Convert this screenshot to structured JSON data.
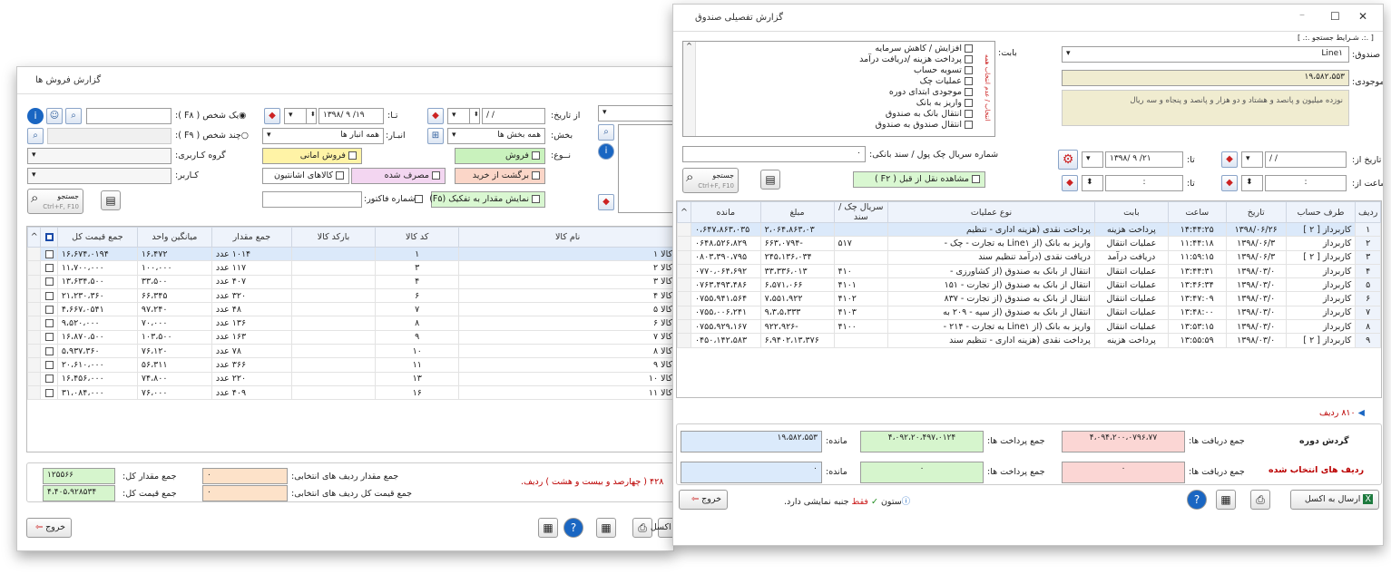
{
  "sales": {
    "title": "گزارش فروش ها",
    "from_date_label": "از تاریخ:",
    "from_date": "/ /",
    "to_label": "تـا:",
    "to_date": "۱۳۹۸/ ۹ /۱۹",
    "single_person": "یک شخص ( F۸ ):",
    "multi_person": "چند شخص ( F۹ ):",
    "section_label": "بخش:",
    "section_value": "همه بخش ها",
    "store_label": "انبـار:",
    "store_value": "همه انبار ها",
    "user_group_label": "گروه کـاربری:",
    "user_label": "کـاربر:",
    "type_label": "نــوع:",
    "type_sale": "فروش",
    "type_trust": "فروش امانی",
    "type_return": "برگشت از خرید",
    "type_consume": "مصرف شده",
    "type_atelier": "کالاهای اشانتیون",
    "show_detail": "نمایش مقدار به تفکیک (F۵)",
    "invoice_label": "شماره فاکتور:",
    "search_label": "جستجو",
    "search_hint": "Ctrl+F, F10",
    "headers": [
      "جمع قیمت کل",
      "میانگین واحد",
      "جمع مقدار",
      "بارکد کالا",
      "کد کالا",
      "نام کالا"
    ],
    "rows": [
      [
        "۱۶،۶۷۴،۰۱۹۴",
        "۱۶،۴۷۲",
        "۱۰۱۴ عدد",
        "",
        "۱",
        "کالا ۱"
      ],
      [
        "۱۱،۷۰۰،۰۰۰",
        "۱۰۰،۰۰۰",
        "۱۱۷ عدد",
        "",
        "۳",
        "کالا ۲"
      ],
      [
        "۱۳،۶۳۴،۵۰۰",
        "۳۳،۵۰۰",
        "۴۰۷ عدد",
        "",
        "۴",
        "کالا ۳"
      ],
      [
        "۲۱،۲۳۰،۳۶۰",
        "۶۶،۳۴۵",
        "۳۲۰ عدد",
        "",
        "۶",
        "کالا ۴"
      ],
      [
        "۴،۶۶۷،۰۵۴۱",
        "۹۷،۲۴۰",
        "۴۸ عدد",
        "",
        "۷",
        "کالا ۵"
      ],
      [
        "۹،۵۲۰،۰۰۰",
        "۷۰،۰۰۰",
        "۱۳۶ عدد",
        "",
        "۸",
        "کالا ۶"
      ],
      [
        "۱۶،۸۷۰،۵۰۰",
        "۱۰۳،۵۰۰",
        "۱۶۳ عدد",
        "",
        "۹",
        "کالا ۷"
      ],
      [
        "۵،۹۳۷،۳۶۰",
        "۷۶،۱۲۰",
        "۷۸ عدد",
        "",
        "۱۰",
        "کالا ۸"
      ],
      [
        "۲۰،۶۱۰،۰۰۰",
        "۵۶،۳۱۱",
        "۳۶۶ عدد",
        "",
        "۱۱",
        "کالا ۹"
      ],
      [
        "۱۶،۴۵۶،۰۰۰",
        "۷۴،۸۰۰",
        "۲۲۰ عدد",
        "",
        "۱۳",
        "کالا ۱۰"
      ],
      [
        "۳۱،۰۸۴،۰۰۰",
        "۷۶،۰۰۰",
        "۴۰۹ عدد",
        "",
        "۱۶",
        "کالا ۱۱"
      ]
    ],
    "row_count_text": "۴۲۸ ( چهارصد و بیست و هشت ) ردیف.",
    "total_qty_label": "جمع مقدار کل:",
    "total_qty": "۱۲۵۵۶۶",
    "total_price_label": "جمع قیمت کل:",
    "total_price": "۴،۴۰۵،۹۲۸۵۳۴",
    "sel_qty_label": "جمع مقدار ردیف های انتخابی:",
    "sel_qty": "۰",
    "sel_price_label": "جمع قیمت کل ردیف های انتخابی:",
    "sel_price": "۰",
    "excel_label": "ارسال به اکسل",
    "exit_label": "خروج"
  },
  "fund": {
    "title": "گزارش تفصیلی صندوق",
    "criteria": "[ .:. شـرایط جستجو .:. ]",
    "fund_label": "صندوق:",
    "fund_value": "Line۱",
    "balance_label": "موجودی:",
    "balance_value": "۱۹،۵۸۲،۵۵۳",
    "balance_words": "نوزده میلیون و پانصد و هشتاد و دو هزار و پانصد و پنجاه و سه ریال",
    "bab_label": "بابت:",
    "side_label": "انتخاب / عدم انتخاب همه",
    "categories": [
      "افزایش / کاهش سرمایه",
      "پرداخت هزینه /دریافت درآمد",
      "تسویه حساب",
      "عملیات چک",
      "موجودی ابتدای دوره",
      "واریز به بانک",
      "انتقال بانک به صندوق",
      "انتقال صندوق به صندوق"
    ],
    "serial_label": "شماره سریال چک پول / سند بانکی:",
    "date_from_label": "تاریخ از:",
    "date_from": "/ /",
    "date_to_label": "تا:",
    "date_to": "۱۳۹۸/ ۹ /۲۱",
    "time_from_label": "ساعت از:",
    "time_from": ":",
    "time_to_label": "تا:",
    "time_to": ":",
    "search_label": "جستجو",
    "search_hint": "Ctrl+F, F10",
    "prev_transfer": "مشاهده نقل از قبل ( F۲ )",
    "headers": [
      "ردیف",
      "طرف حساب",
      "تاریخ",
      "ساعت",
      "بابت",
      "نوع عملیات",
      "سریال چک / سند",
      "مبلغ",
      "مانده"
    ],
    "rows": [
      [
        "۱",
        "کاربرداز [ ۲ ]",
        "۱۳۹۸/۰۶/۲۶",
        "۱۴:۴۴:۲۵",
        "پرداخت هزینه",
        "پرداخت نقدی (هزینه اداری - تنظیم",
        "",
        "۲،۰۶۴،۸۶۳،۰۳",
        "۰،۶۴۷،۸۶۳،۰۳۵"
      ],
      [
        "۲",
        "کاربرداز",
        "۱۳۹۸/۰۶/۳",
        "۱۱:۴۴:۱۸",
        "عملیات انتقال",
        "واریز به بانک (از Line۱ به تجارت - چک -",
        "۵۱۷",
        "-۶۶۳،۰۷۹۴",
        "۰۶۴۸،۵۲۶،۸۲۹"
      ],
      [
        "۳",
        "کاربرداز [ ۲ ]",
        "۱۳۹۸/۰۶/۳",
        "۱۱:۵۹:۱۵",
        "دریافت درآمد",
        "دریافت نقدی (درآمد تنظیم سند",
        "",
        "۲۴۵،۱۳۶،۰۳۴",
        "۰۸۰۳،۳۹۰،۷۹۵"
      ],
      [
        "۴",
        "کاربرداز",
        "۱۳۹۸/۰۳/۰",
        "۱۳:۴۴:۳۱",
        "عملیات انتقال",
        "انتقال از بانک به صندوق (از کشاورزی -",
        "۴۱۰",
        "۳۳،۳۳۶،۰۱۳",
        "۰۷۷۰،۰۶۴،۶۹۲"
      ],
      [
        "۵",
        "کاربرداز",
        "۱۳۹۸/۰۳/۰",
        "۱۳:۴۶:۳۴",
        "عملیات انتقال",
        "انتقال از بانک به صندوق (از تجارت - ۱۵۱",
        "۴۱۰۱",
        "۶،۵۷۱،۰۶۶",
        "۰۷۶۳،۴۹۳،۴۸۶"
      ],
      [
        "۶",
        "کاربرداز",
        "۱۳۹۸/۰۳/۰",
        "۱۳:۴۷:۰۹",
        "عملیات انتقال",
        "انتقال از بانک به صندوق (از تجارت - ۸۳۷",
        "۴۱۰۲",
        "۷،۵۵۱،۹۲۲",
        "۰۷۵۵،۹۴۱،۵۶۴"
      ],
      [
        "۷",
        "کاربرداز",
        "۱۳۹۸/۰۳/۰",
        "۱۳:۴۸:۰۰",
        "عملیات انتقال",
        "انتقال از بانک به صندوق (از سپه - ۲۰۹ به",
        "۴۱۰۳",
        "۹،۳،۵،۳۳۳",
        "۰۷۵۵،۰۰۶،۲۴۱"
      ],
      [
        "۸",
        "کاربرداز",
        "۱۳۹۸/۰۳/۰",
        "۱۳:۵۳:۱۵",
        "عملیات انتقال",
        "واریز به بانک (از Line۱ به تجارت - ۲۱۴ -",
        "۴۱۰۰",
        "-۹۲۲،۹۲۶",
        "۰۷۵۵،۹۲۹،۱۶۷"
      ],
      [
        "۹",
        "کاربرداز [ ۲ ]",
        "۱۳۹۸/۰۳/۰",
        "۱۳:۵۵:۵۹",
        "پرداخت هزینه",
        "پرداخت نقدی (هزینه اداری - تنظیم سند",
        "",
        "۶،۹۴۰۲،۱۳،۳۷۶",
        "۰۴۵۰،۱۴۲،۵۸۳"
      ]
    ],
    "row_count": "۸۱۰ ردیف",
    "period_label": "گردش دوره",
    "selected_label": "ردیف های انتخاب شده",
    "recv_label": "جمع دریافت ها:",
    "recv_total": "۴،۰۹۴،۲۰۰،۰۷۹۶،۷۷",
    "pay_label": "جمع پرداخت ها:",
    "pay_total": "۴،۰۹۲،۲۰،۴۹۷،۰۱۲۴",
    "remain_label": "مانده:",
    "remain_total": "۱۹،۵۸۲،۵۵۳",
    "recv_sel": "۰",
    "pay_sel": "۰",
    "remain_sel": "۰",
    "column_note_prefix": "ستون",
    "column_note_only": "فقط",
    "column_note_suffix": "جنبه نمایشی دارد.",
    "excel_label": "ارسال به اکسل",
    "exit_label": "خروج"
  }
}
